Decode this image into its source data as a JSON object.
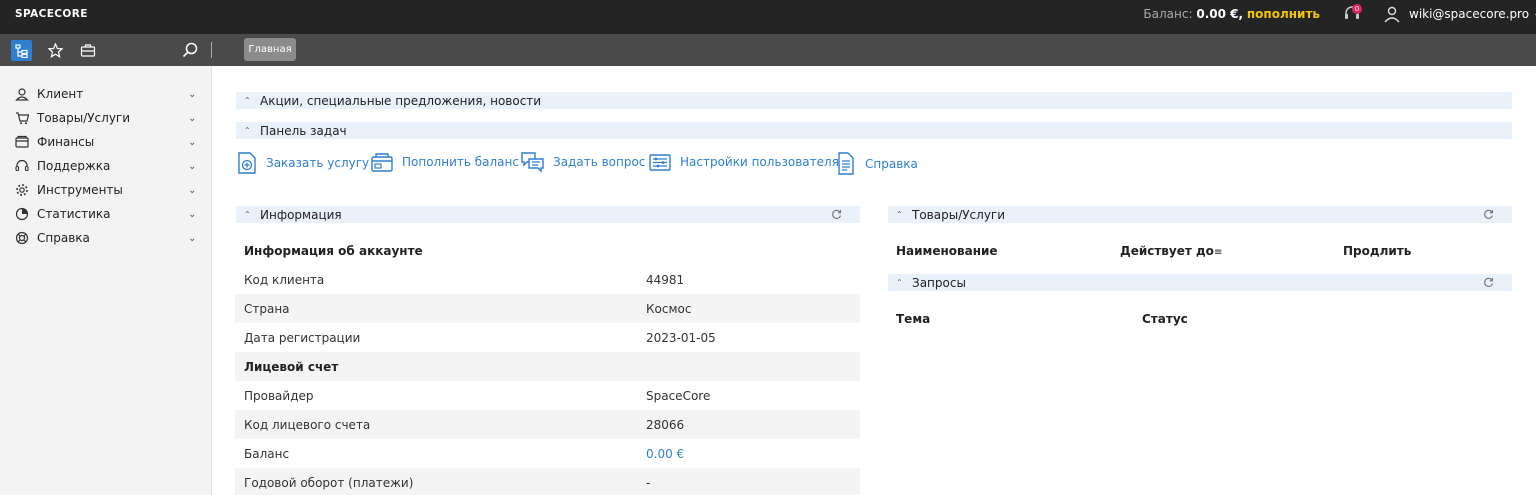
{
  "topbar": {
    "logo": "SPACECORE",
    "balance_label": "Баланс:",
    "balance_value": "0.00 €,",
    "topup_label": "пополнить",
    "notifications_count": "0",
    "user_email": "wiki@spacecore.pro"
  },
  "toolbar": {
    "tabs": [
      {
        "label": "Главная"
      }
    ]
  },
  "sidebar": {
    "items": [
      {
        "label": "Клиент",
        "icon": "user-icon"
      },
      {
        "label": "Товары/Услуги",
        "icon": "cart-icon"
      },
      {
        "label": "Финансы",
        "icon": "wallet-icon"
      },
      {
        "label": "Поддержка",
        "icon": "headset-icon"
      },
      {
        "label": "Инструменты",
        "icon": "gear-icon"
      },
      {
        "label": "Статистика",
        "icon": "pie-chart-icon"
      },
      {
        "label": "Справка",
        "icon": "lifebuoy-icon"
      }
    ]
  },
  "sections": {
    "news": "Акции, специальные предложения, новости",
    "tasks": "Панель задач",
    "info": "Информация",
    "services": "Товары/Услуги",
    "requests": "Запросы"
  },
  "tasks": [
    {
      "label": "Заказать услугу",
      "icon": "order-icon"
    },
    {
      "label": "Пополнить баланс",
      "icon": "wallet-icon"
    },
    {
      "label": "Задать вопрос",
      "icon": "chat-icon"
    },
    {
      "label": "Настройки пользователя",
      "icon": "settings-list-icon"
    },
    {
      "label": "Справка",
      "icon": "document-icon"
    }
  ],
  "info": {
    "rows": [
      {
        "key": "Информация об аккаунте",
        "value": ""
      },
      {
        "key": "Код клиента",
        "value": "44981"
      },
      {
        "key": "Страна",
        "value": "Космос"
      },
      {
        "key": "Дата регистрации",
        "value": "2023-01-05"
      },
      {
        "key": "Лицевой счет",
        "value": ""
      },
      {
        "key": "Провайдер",
        "value": "SpaceCore"
      },
      {
        "key": "Код лицевого счета",
        "value": "28066"
      },
      {
        "key": "Баланс",
        "value": "0.00 €"
      },
      {
        "key": "Годовой оборот (платежи)",
        "value": "-"
      }
    ]
  },
  "services_table": {
    "columns": [
      "Наименование",
      "Действует до",
      "Продлить"
    ]
  },
  "requests_table": {
    "columns": [
      "Тема",
      "Статус"
    ]
  },
  "colors": {
    "accent": "#2f7fd0",
    "topup": "#f3c500",
    "topbar": "#242424",
    "toolbar": "#4a4a4a",
    "section_header": "#e9f1fb"
  }
}
